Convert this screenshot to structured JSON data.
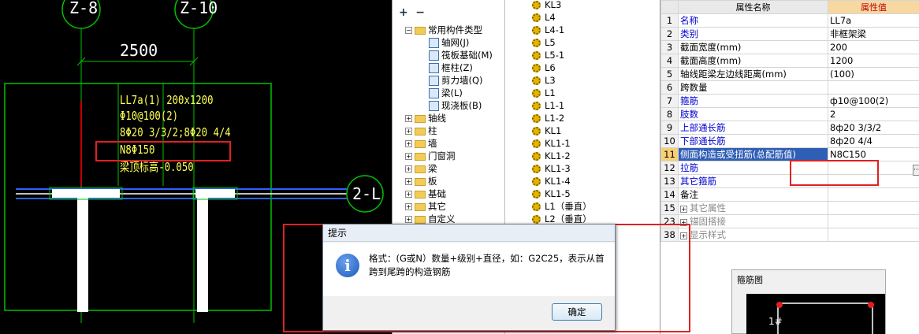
{
  "drawing": {
    "axis_top_left": "Z-8",
    "axis_top_right": "Z-10",
    "dimension": "2500",
    "axis_right": "2-L",
    "beam_label_lines": [
      "LL7a(1) 200x1200",
      "Φ10@100(2)",
      "8Φ20 3/3/2;8Φ20 4/4",
      "N8Φ150",
      "梁顶标高-0.050"
    ]
  },
  "toolbar": {
    "expand_all": "+",
    "collapse_all": "−"
  },
  "component_tree": {
    "root": "常用构件类型",
    "children": [
      "轴网(J)",
      "筏板基础(M)",
      "框柱(Z)",
      "剪力墙(Q)",
      "梁(L)",
      "现浇板(B)"
    ],
    "groups": [
      "轴线",
      "柱",
      "墙",
      "门窗洞",
      "梁",
      "板",
      "基础",
      "其它",
      "自定义"
    ]
  },
  "beam_list": [
    "KL3",
    "L4",
    "L4-1",
    "L5",
    "L5-1",
    "L6",
    "L3",
    "L1",
    "L1-1",
    "L1-2",
    "KL1",
    "KL1-1",
    "KL1-2",
    "KL1-3",
    "KL1-4",
    "KL1-5",
    "L1（垂直）",
    "L2（垂直）"
  ],
  "properties": {
    "header_name": "属性名称",
    "header_value": "属性值",
    "rows": [
      {
        "num": "1",
        "name": "名称",
        "value": "LL7a",
        "style": "blue"
      },
      {
        "num": "2",
        "name": "类别",
        "value": "非框架梁",
        "style": "blue"
      },
      {
        "num": "3",
        "name": "截面宽度(mm)",
        "value": "200",
        "style": ""
      },
      {
        "num": "4",
        "name": "截面高度(mm)",
        "value": "1200",
        "style": ""
      },
      {
        "num": "5",
        "name": "轴线距梁左边线距离(mm)",
        "value": "(100)",
        "style": ""
      },
      {
        "num": "6",
        "name": "跨数量",
        "value": "",
        "style": ""
      },
      {
        "num": "7",
        "name": "箍筋",
        "value": "ф10@100(2)",
        "style": "blue"
      },
      {
        "num": "8",
        "name": "肢数",
        "value": "2",
        "style": "blue"
      },
      {
        "num": "9",
        "name": "上部通长筋",
        "value": "8ф20 3/3/2",
        "style": "blue"
      },
      {
        "num": "10",
        "name": "下部通长筋",
        "value": "8ф20 4/4",
        "style": "blue"
      },
      {
        "num": "11",
        "name": "侧面构造或受扭筋(总配筋值)",
        "value": "N8C150",
        "style": "sel"
      },
      {
        "num": "12",
        "name": "拉筋",
        "value": "",
        "style": "blue"
      },
      {
        "num": "13",
        "name": "其它箍筋",
        "value": "",
        "style": "blue"
      },
      {
        "num": "14",
        "name": "备注",
        "value": "",
        "style": ""
      },
      {
        "num": "15",
        "name": "其它属性",
        "value": "",
        "style": "group"
      },
      {
        "num": "23",
        "name": "锚固搭接",
        "value": "",
        "style": "group"
      },
      {
        "num": "38",
        "name": "显示样式",
        "value": "",
        "style": "group"
      }
    ],
    "more_button": "···"
  },
  "stirrup_panel": {
    "title": "箍筋图",
    "label": "1#"
  },
  "dialog": {
    "title": "提示",
    "message": "格式：(G或N）数量+级别+直径，如：G2C25，表示从首跨到尾跨的构造钢筋",
    "ok": "确定"
  },
  "colors": {
    "annotation_red": "#e02020",
    "cad_yellow": "#ffff55",
    "cad_green": "#00c000",
    "selection": "#2f5eb5"
  }
}
